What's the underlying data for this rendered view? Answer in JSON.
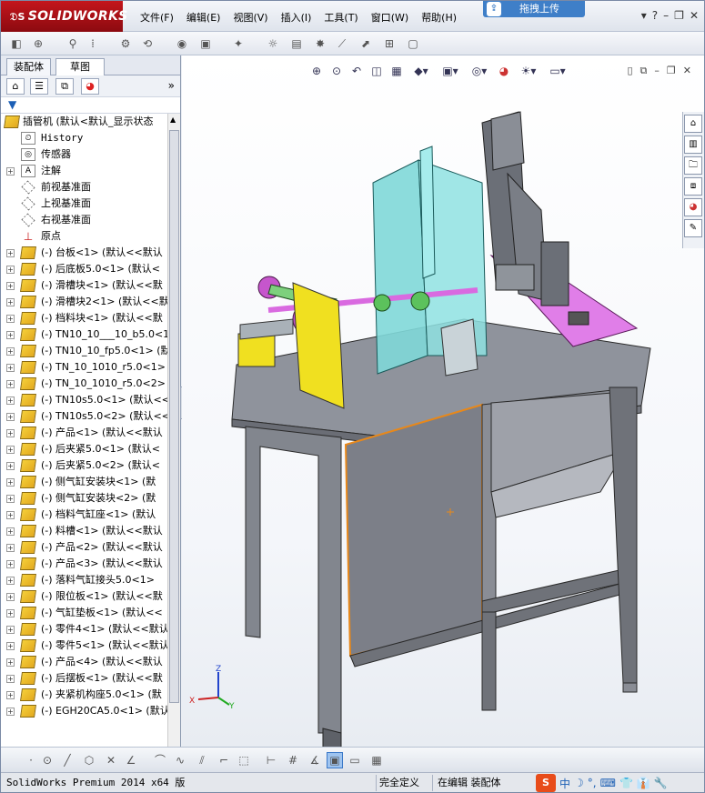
{
  "app": {
    "brand": "SOLIDWORKS",
    "upload_label": "拖拽上传"
  },
  "menu": [
    "文件(F)",
    "编辑(E)",
    "视图(V)",
    "插入(I)",
    "工具(T)",
    "窗口(W)",
    "帮助(H)"
  ],
  "left_panel": {
    "tabs": [
      "装配体",
      "草图"
    ],
    "active_tab": "草图"
  },
  "tree": {
    "root": "插管机  (默认<默认_显示状态",
    "items": [
      {
        "label": "History",
        "icon": "history-icon",
        "mono": true
      },
      {
        "label": "传感器",
        "icon": "sensor-icon"
      },
      {
        "label": "注解",
        "icon": "annotation-icon",
        "expand": true
      },
      {
        "label": "前视基准面",
        "icon": "plane-icon"
      },
      {
        "label": "上视基准面",
        "icon": "plane-icon"
      },
      {
        "label": "右视基准面",
        "icon": "plane-icon"
      },
      {
        "label": "原点",
        "icon": "origin-icon"
      }
    ],
    "parts": [
      "(-) 台板<1> (默认<<默认",
      "(-) 后底板5.0<1> (默认<",
      "(-) 滑槽块<1> (默认<<默",
      "(-) 滑槽块2<1> (默认<<默",
      "(-) 档料块<1> (默认<<默",
      "(-) TN10_10___10_b5.0<1",
      "(-) TN10_10_fp5.0<1> (默",
      "(-) TN_10_1010_r5.0<1>",
      "(-) TN_10_1010_r5.0<2>",
      "(-) TN10s5.0<1> (默认<<",
      "(-) TN10s5.0<2> (默认<<",
      "(-) 产品<1> (默认<<默认",
      "(-) 后夹紧5.0<1> (默认<",
      "(-) 后夹紧5.0<2> (默认<",
      "(-) 侧气缸安装块<1> (默",
      "(-) 侧气缸安装块<2> (默",
      "(-) 档料气缸座<1> (默认",
      "(-) 料槽<1> (默认<<默认",
      "(-) 产品<2> (默认<<默认",
      "(-) 产品<3> (默认<<默认",
      "(-) 落料气缸接头5.0<1>",
      "(-) 限位板<1> (默认<<默",
      "(-) 气缸垫板<1> (默认<<",
      "(-) 零件4<1> (默认<<默认",
      "(-) 零件5<1> (默认<<默认",
      "(-) 产品<4> (默认<<默认",
      "(-) 后摆板<1> (默认<<默",
      "(-) 夹紧机构座5.0<1> (默",
      "(-) EGH20CA5.0<1> (默认"
    ]
  },
  "status": {
    "version": "SolidWorks Premium 2014 x64 版",
    "state1": "完全定义",
    "state2": "在编辑 装配体"
  },
  "ime": [
    "中",
    "☽",
    "°,",
    "⌨",
    "👕",
    "👔",
    "🔧"
  ],
  "colors": {
    "brand_red": "#c4161c",
    "table_gray": "#7a7d86",
    "panel_cyan": "#7fd8d8",
    "part_yellow": "#f0e020",
    "plate_magenta": "#e07ee8",
    "accent_orange": "#e8881a"
  }
}
